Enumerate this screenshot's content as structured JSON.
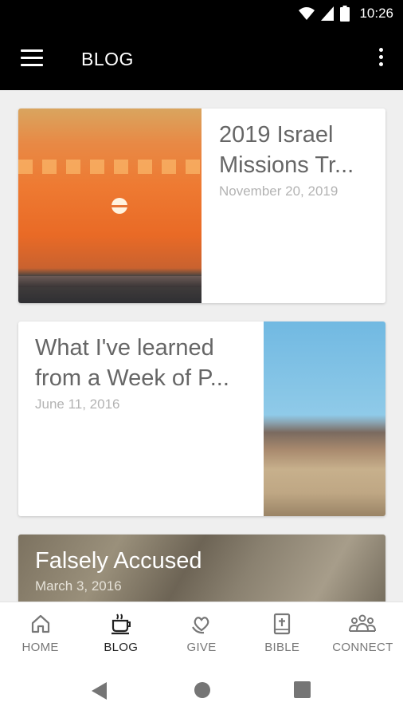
{
  "status": {
    "time": "10:26"
  },
  "app": {
    "title": "BLOG"
  },
  "posts": [
    {
      "title": "2019 Israel Missions Tr...",
      "date": "November 20, 2019"
    },
    {
      "title": "What I've learned from a Week of P...",
      "date": "June 11, 2016"
    },
    {
      "title": "Falsely Accused",
      "date": "March 3, 2016"
    }
  ],
  "nav": [
    {
      "label": "HOME",
      "icon": "home-icon"
    },
    {
      "label": "BLOG",
      "icon": "coffee-cup-icon",
      "active": true
    },
    {
      "label": "GIVE",
      "icon": "hand-heart-icon"
    },
    {
      "label": "BIBLE",
      "icon": "bible-icon"
    },
    {
      "label": "CONNECT",
      "icon": "group-icon"
    }
  ],
  "colors": {
    "appbar": "#000000",
    "background": "#efefef",
    "title_text": "#666666",
    "date_text": "#b3b3b3"
  }
}
